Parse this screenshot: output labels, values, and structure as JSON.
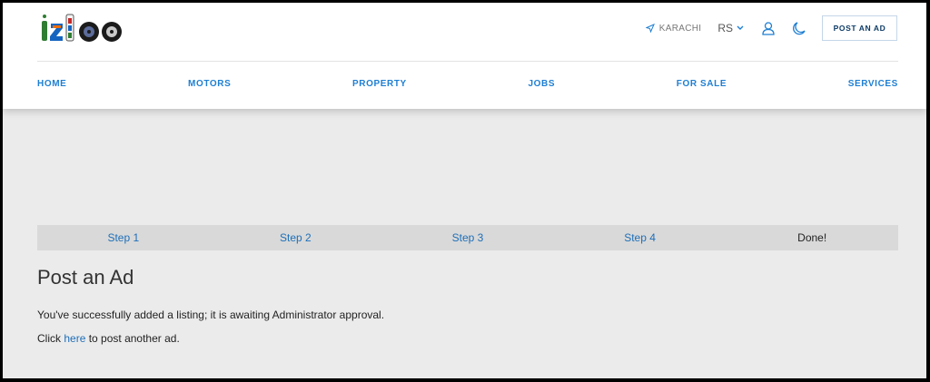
{
  "brand": {
    "logo_text": "izloo"
  },
  "header": {
    "location": "KARACHI",
    "currency": "RS",
    "post_button": "POST AN AD"
  },
  "nav": {
    "items": [
      "HOME",
      "MOTORS",
      "PROPERTY",
      "JOBS",
      "FOR SALE",
      "SERVICES"
    ]
  },
  "steps": {
    "items": [
      "Step 1",
      "Step 2",
      "Step 3",
      "Step 4",
      "Done!"
    ],
    "current": "Done!"
  },
  "content": {
    "title": "Post an Ad",
    "success_message": "You've successfully added a listing; it is awaiting Administrator approval.",
    "click_prefix": "Click",
    "link_text": "here",
    "click_suffix": "to post another ad."
  },
  "icons": {
    "location": "navigation-arrow-icon",
    "currency_dropdown": "chevron-down-icon",
    "account": "user-icon",
    "theme": "moon-icon"
  },
  "colors": {
    "link": "#1e7fd3",
    "page_bg": "#ebebeb",
    "step_bar": "#d9d9d9"
  }
}
